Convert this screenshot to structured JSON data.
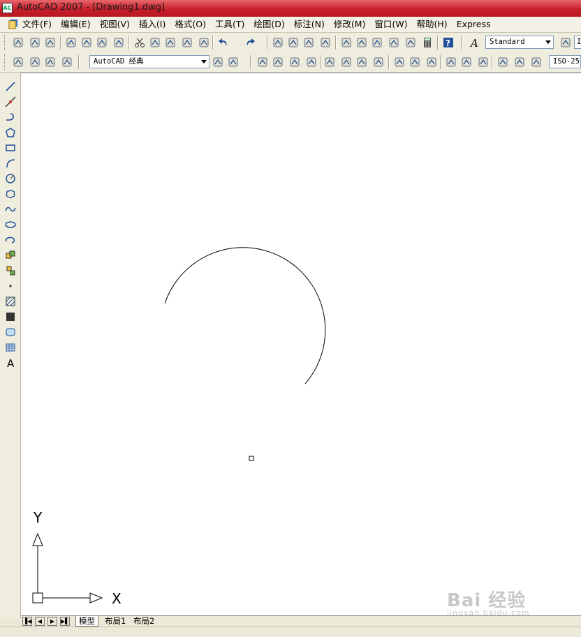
{
  "window": {
    "title": "AutoCAD 2007 - [Drawing1.dwg]"
  },
  "menu": [
    "文件(F)",
    "编辑(E)",
    "视图(V)",
    "插入(I)",
    "格式(O)",
    "工具(T)",
    "绘图(D)",
    "标注(N)",
    "修改(M)",
    "窗口(W)",
    "帮助(H)",
    "Express"
  ],
  "toolbar": {
    "text_style": "Standard",
    "text_style_2": "I",
    "workspace": "AutoCAD 经典",
    "dim_style": "ISO-25"
  },
  "layout_tabs": [
    "模型",
    "布局1",
    "布局2"
  ],
  "ucs": {
    "x_label": "X",
    "y_label": "Y"
  },
  "watermark": {
    "logo": "Bai 经验",
    "url": "jingyan.baidu.com"
  },
  "icons": {
    "standard": [
      "new-icon",
      "open-icon",
      "save-icon",
      "plot-icon",
      "plot-preview-icon",
      "publish-icon",
      "3d-dwf-icon",
      "cut-icon",
      "copy-icon",
      "paste-icon",
      "match-properties-icon",
      "block-editor-icon",
      "undo-icon",
      "redo-icon",
      "pan-icon",
      "zoom-realtime-icon",
      "zoom-window-icon",
      "zoom-previous-icon",
      "properties-icon",
      "design-center-icon",
      "tool-palettes-icon",
      "sheet-set-icon",
      "markup-icon",
      "calculator-icon",
      "help-icon",
      "text-style-icon",
      "dim-style-icon"
    ],
    "draw": [
      "line-icon",
      "construction-line-icon",
      "polyline-icon",
      "polygon-icon",
      "rectangle-icon",
      "arc-icon",
      "circle-icon",
      "revision-cloud-icon",
      "spline-icon",
      "ellipse-icon",
      "ellipse-arc-icon",
      "insert-block-icon",
      "make-block-icon",
      "point-icon",
      "hatch-icon",
      "gradient-icon",
      "region-icon",
      "table-icon",
      "multiline-text-icon"
    ]
  }
}
